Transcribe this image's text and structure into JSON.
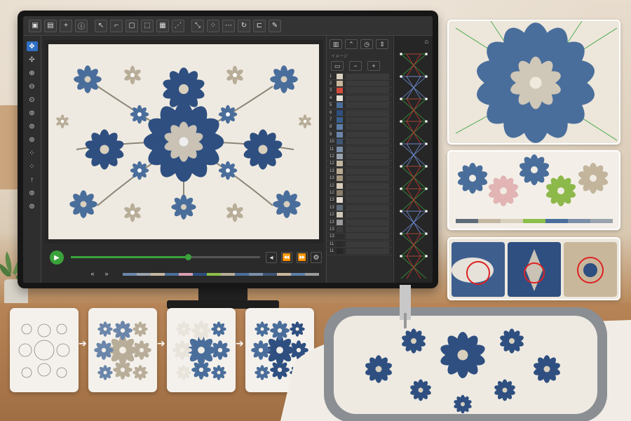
{
  "colors": {
    "accent": "#2f6fc4",
    "play": "#3aa23a",
    "navy": "#2e4f80",
    "denim": "#4a6e9b",
    "beige": "#b8ad98",
    "fabric": "#efeae1"
  },
  "toolbar": {
    "icons": [
      "save-icon",
      "clipboard-icon",
      "add-icon",
      "info-icon",
      "select-icon",
      "crop-icon",
      "shape-icon",
      "frame-icon",
      "grid-icon",
      "stitch-icon",
      "transform-icon",
      "node-icon",
      "points-icon",
      "rotate-icon",
      "hoop-icon",
      "needle-icon"
    ]
  },
  "left_tools": {
    "icons": [
      "move-icon",
      "pan-icon",
      "zoom-in-icon",
      "zoom-out-icon",
      "zoom-fit-icon",
      "zoom-icon",
      "zoom-icon",
      "zoom-icon",
      "node-icon",
      "node-icon",
      "arrow-up-icon",
      "zoom-icon",
      "zoom-icon"
    ]
  },
  "playback": {
    "progress": 0.62,
    "icons": [
      "play-icon",
      "skip-back-icon",
      "rewind-icon",
      "forward-icon",
      "settings-icon"
    ]
  },
  "color_panel": {
    "header_icons": [
      "layers-icon",
      "chevron-up-icon",
      "timer-icon",
      "sort-icon"
    ],
    "sub_label": "イメージ",
    "rows": [
      {
        "num": "1",
        "color": "#d8cfbd"
      },
      {
        "num": "2",
        "color": "#c9b79c"
      },
      {
        "num": "3",
        "color": "#d24a3a"
      },
      {
        "num": "4",
        "color": "#e7e2d8"
      },
      {
        "num": "5",
        "color": "#4a6e9b"
      },
      {
        "num": "6",
        "color": "#2e4f80"
      },
      {
        "num": "7",
        "color": "#3b5f8c"
      },
      {
        "num": "8",
        "color": "#5d7fa8"
      },
      {
        "num": "9",
        "color": "#6b86aa"
      },
      {
        "num": "10",
        "color": "#3e5574"
      },
      {
        "num": "11",
        "color": "#7b8fa8"
      },
      {
        "num": "12",
        "color": "#9aa3ad"
      },
      {
        "num": "12",
        "color": "#c4b7a1"
      },
      {
        "num": "13",
        "color": "#b9aa92"
      },
      {
        "num": "13",
        "color": "#a39580"
      },
      {
        "num": "12",
        "color": "#d7ccb9"
      },
      {
        "num": "12",
        "color": "#8a7d6b"
      },
      {
        "num": "13",
        "color": "#e3dccf"
      },
      {
        "num": "13",
        "color": "#5f6b78"
      },
      {
        "num": "12",
        "color": "#cfc7b8"
      },
      {
        "num": "13",
        "color": "#9b9b9b"
      },
      {
        "num": "13",
        "color": "#3a3a3a"
      },
      {
        "num": "13",
        "color": "#2c2c2c"
      },
      {
        "num": "11",
        "color": "#2a2a2a"
      },
      {
        "num": "11",
        "color": "#262626"
      }
    ]
  },
  "color_strip": [
    "#6b86aa",
    "#9aa3ad",
    "#c4b7a1",
    "#4a6e9b",
    "#d8a0b0",
    "#2e4f80",
    "#8dbf4a",
    "#b8ad98",
    "#4a6e9b",
    "#7b8fa8",
    "#3e5574",
    "#c9b79c",
    "#5d7fa8",
    "#9b9b9b"
  ],
  "variant_colors": [
    "#4a6e9b",
    "#e2b4b4",
    "#4a6e9b",
    "#8db84a",
    "#c2b59c"
  ],
  "variant_bar": [
    "#5f6b78",
    "#c4b7a1",
    "#d8cfbd",
    "#8dbf4a",
    "#4a6e9b",
    "#7b8fa8",
    "#9aa3ad"
  ]
}
